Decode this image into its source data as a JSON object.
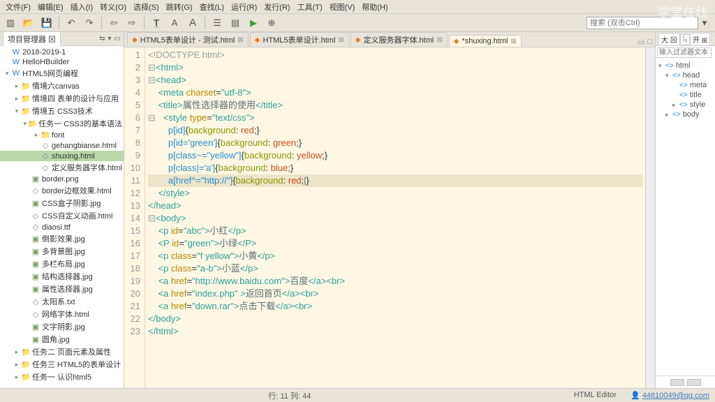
{
  "menu": [
    "文件(F)",
    "编辑(E)",
    "插入(I)",
    "转义(O)",
    "选择(S)",
    "跳转(G)",
    "查找(L)",
    "运行(R)",
    "发行(R)",
    "工具(T)",
    "视图(V)",
    "帮助(H)"
  ],
  "search_placeholder": "搜索 (双击Ctrl)",
  "watermark": "学堂在线",
  "sidebar_title": "项目管理器",
  "tree": [
    {
      "d": 0,
      "exp": "",
      "ico": "W",
      "cls": "ico-w",
      "label": "2018-2019-1"
    },
    {
      "d": 0,
      "exp": "",
      "ico": "W",
      "cls": "ico-w",
      "label": "HelloHBuilder"
    },
    {
      "d": 0,
      "exp": "▾",
      "ico": "W",
      "cls": "ico-w",
      "label": "HTML5网页编程"
    },
    {
      "d": 1,
      "exp": "▸",
      "ico": "📁",
      "cls": "ico-folder",
      "label": "情境六canvas"
    },
    {
      "d": 1,
      "exp": "▸",
      "ico": "📁",
      "cls": "ico-folder",
      "label": "情境四 表单的设计与应用"
    },
    {
      "d": 1,
      "exp": "▾",
      "ico": "📁",
      "cls": "ico-folder",
      "label": "情境五 CSS3技术"
    },
    {
      "d": 2,
      "exp": "▾",
      "ico": "📁",
      "cls": "ico-folder",
      "label": "任务一 CSS3的基本语法"
    },
    {
      "d": 3,
      "exp": "▸",
      "ico": "📁",
      "cls": "ico-folder",
      "label": "font"
    },
    {
      "d": 3,
      "exp": "",
      "ico": "◇",
      "cls": "ico-file",
      "label": "gehangbianse.html"
    },
    {
      "d": 3,
      "exp": "",
      "ico": "◇",
      "cls": "ico-file",
      "label": "shuxing.html",
      "sel": true
    },
    {
      "d": 3,
      "exp": "",
      "ico": "◇",
      "cls": "ico-file",
      "label": "定义服务器字体.html"
    },
    {
      "d": 2,
      "exp": "",
      "ico": "▣",
      "cls": "ico-img",
      "label": "border.png"
    },
    {
      "d": 2,
      "exp": "",
      "ico": "◇",
      "cls": "ico-file",
      "label": "border边框效果.html"
    },
    {
      "d": 2,
      "exp": "",
      "ico": "▣",
      "cls": "ico-img",
      "label": "CSS盒子阴影.jpg"
    },
    {
      "d": 2,
      "exp": "",
      "ico": "◇",
      "cls": "ico-file",
      "label": "CSS自定义动画.html"
    },
    {
      "d": 2,
      "exp": "",
      "ico": "◇",
      "cls": "ico-file",
      "label": "diaosi.ttf"
    },
    {
      "d": 2,
      "exp": "",
      "ico": "▣",
      "cls": "ico-img",
      "label": "倒影效果.jpg"
    },
    {
      "d": 2,
      "exp": "",
      "ico": "▣",
      "cls": "ico-img",
      "label": "多背景图.jpg"
    },
    {
      "d": 2,
      "exp": "",
      "ico": "▣",
      "cls": "ico-img",
      "label": "多栏布局.jpg"
    },
    {
      "d": 2,
      "exp": "",
      "ico": "▣",
      "cls": "ico-img",
      "label": "结构选择器.jpg"
    },
    {
      "d": 2,
      "exp": "",
      "ico": "▣",
      "cls": "ico-img",
      "label": "属性选择器.jpg"
    },
    {
      "d": 2,
      "exp": "",
      "ico": "◇",
      "cls": "ico-file",
      "label": "太阳系.txt"
    },
    {
      "d": 2,
      "exp": "",
      "ico": "◇",
      "cls": "ico-file",
      "label": "网络字体.html"
    },
    {
      "d": 2,
      "exp": "",
      "ico": "▣",
      "cls": "ico-img",
      "label": "文字阴影.jpg"
    },
    {
      "d": 2,
      "exp": "",
      "ico": "▣",
      "cls": "ico-img",
      "label": "圆角.jpg"
    },
    {
      "d": 1,
      "exp": "▸",
      "ico": "📁",
      "cls": "ico-folder",
      "label": "任务二 页面元素及属性"
    },
    {
      "d": 1,
      "exp": "▸",
      "ico": "📁",
      "cls": "ico-folder",
      "label": "任务三 HTML5的表单设计"
    },
    {
      "d": 1,
      "exp": "▸",
      "ico": "📁",
      "cls": "ico-folder",
      "label": "任务一 认识html5"
    }
  ],
  "tabs": [
    {
      "label": "HTML5表单设计 - 测试.html",
      "active": false
    },
    {
      "label": "HTML5表单设计.html",
      "active": false
    },
    {
      "label": "定义服务器字体.html",
      "active": false
    },
    {
      "label": "*shuxing.html",
      "active": true
    }
  ],
  "code": [
    {
      "n": 1,
      "html": "<span class='k-doctype'>&lt;!DOCTYPE html&gt;</span>"
    },
    {
      "n": 2,
      "html": "<span class='k-punc'>⊟</span><span class='k-tag'>&lt;html&gt;</span>"
    },
    {
      "n": 3,
      "html": "<span class='k-punc'>⊟</span><span class='k-tag'>&lt;head&gt;</span>"
    },
    {
      "n": 4,
      "html": "    <span class='k-tag'>&lt;meta</span> <span class='k-attr'>charset</span>=<span class='k-str'>\"utf-8\"</span><span class='k-tag'>&gt;</span>"
    },
    {
      "n": 5,
      "html": "    <span class='k-tag'>&lt;title&gt;</span><span class='k-text'>属性选择器的使用</span><span class='k-tag'>&lt;/title&gt;</span>"
    },
    {
      "n": 6,
      "html": "<span class='k-punc'>⊟</span>   <span class='k-tag'>&lt;style</span> <span class='k-attr'>type</span>=<span class='k-str'>\"text/css\"</span><span class='k-tag'>&gt;</span>"
    },
    {
      "n": 7,
      "html": "        <span class='k-sel'>p[id]</span>{<span class='k-prop'>background</span>: <span class='k-val'>red</span>;}"
    },
    {
      "n": 8,
      "html": "        <span class='k-sel'>p[id='green']</span>{<span class='k-prop'>background</span>: <span class='k-val'>green</span>;}"
    },
    {
      "n": 9,
      "html": "        <span class='k-sel'>p[class~=\"yellow\"]</span>{<span class='k-prop'>background</span>: <span class='k-val'>yellow</span>;}"
    },
    {
      "n": 10,
      "html": "        <span class='k-sel'>p[class|='a']</span>{<span class='k-prop'>background</span>: <span class='k-val'>blue</span>;}"
    },
    {
      "n": 11,
      "cur": true,
      "html": "        <span class='k-sel'>a[href^=\"http://\"]</span>{<span class='k-prop'>background</span>: <span class='k-val'>red</span>;<span class='k-text'>|</span>}"
    },
    {
      "n": 12,
      "html": "    <span class='k-tag'>&lt;/style&gt;</span>"
    },
    {
      "n": 13,
      "html": "<span class='k-tag'>&lt;/head&gt;</span>"
    },
    {
      "n": 14,
      "html": "<span class='k-punc'>⊟</span><span class='k-tag'>&lt;body&gt;</span>"
    },
    {
      "n": 15,
      "html": "    <span class='k-tag'>&lt;p</span> <span class='k-attr'>id</span>=<span class='k-str'>\"abc\"</span><span class='k-tag'>&gt;</span><span class='k-text'>小红</span><span class='k-tag'>&lt;/p&gt;</span>"
    },
    {
      "n": 16,
      "html": "    <span class='k-tag'>&lt;P</span> <span class='k-attr'>id</span>=<span class='k-str'>\"green\"</span><span class='k-tag'>&gt;</span><span class='k-text'>小绿</span><span class='k-tag'>&lt;/P&gt;</span>"
    },
    {
      "n": 17,
      "html": "    <span class='k-tag'>&lt;p</span> <span class='k-attr'>class</span>=<span class='k-str'>\"f yellow\"</span><span class='k-tag'>&gt;</span><span class='k-text'>小黄</span><span class='k-tag'>&lt;/p&gt;</span>"
    },
    {
      "n": 18,
      "html": "    <span class='k-tag'>&lt;p</span> <span class='k-attr'>class</span>=<span class='k-str'>\"a-b\"</span><span class='k-tag'>&gt;</span><span class='k-text'>小蓝</span><span class='k-tag'>&lt;/p&gt;</span>"
    },
    {
      "n": 19,
      "html": "    <span class='k-tag'>&lt;a</span> <span class='k-attr'>href</span>=<span class='k-str'>\"http://www.baidu.com\"</span><span class='k-tag'>&gt;</span><span class='k-text'>百度</span><span class='k-tag'>&lt;/a&gt;&lt;br&gt;</span>"
    },
    {
      "n": 20,
      "html": "    <span class='k-tag'>&lt;a</span> <span class='k-attr'>href</span>=<span class='k-str'>\"index.php\"</span> <span class='k-tag'>&gt;</span><span class='k-text'>返回首页</span><span class='k-tag'>&lt;/a&gt;&lt;br&gt;</span>"
    },
    {
      "n": 21,
      "html": "    <span class='k-tag'>&lt;a</span> <span class='k-attr'>href</span>=<span class='k-str'>\"down.rar\"</span><span class='k-tag'>&gt;</span><span class='k-text'>点击下载</span><span class='k-tag'>&lt;/a&gt;&lt;br&gt;</span>"
    },
    {
      "n": 22,
      "html": "<span class='k-tag'>&lt;/body&gt;</span>"
    },
    {
      "n": 23,
      "html": "<span class='k-tag'>&lt;/html&gt;</span>"
    }
  ],
  "outline_tabs": [
    "大 ⊠",
    "⁞₁",
    "开 ⊞"
  ],
  "outline_filter": "输入过滤器文本",
  "outline": [
    {
      "d": 0,
      "exp": "▾",
      "label": "html"
    },
    {
      "d": 1,
      "exp": "▾",
      "label": "head"
    },
    {
      "d": 2,
      "exp": "",
      "label": "meta"
    },
    {
      "d": 2,
      "exp": "",
      "label": "title"
    },
    {
      "d": 2,
      "exp": "▸",
      "label": "style"
    },
    {
      "d": 1,
      "exp": "▸",
      "label": "body"
    }
  ],
  "status": {
    "pos": "行: 11 列: 44",
    "mode": "HTML Editor",
    "email": "44810049@qq.com",
    "user_ico": "👤"
  }
}
